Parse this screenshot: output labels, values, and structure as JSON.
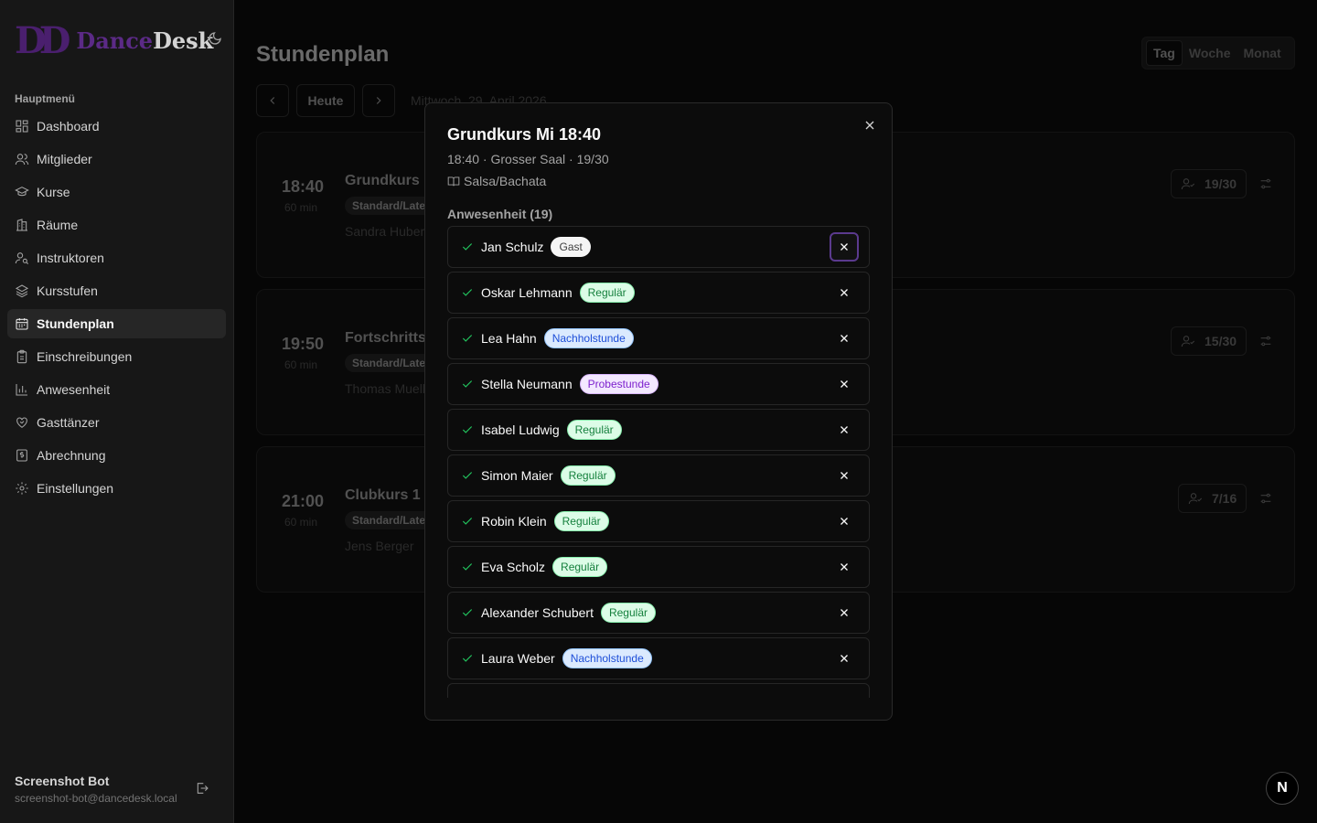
{
  "app": {
    "logo_mark": "DD",
    "logo_part1": "Dance",
    "logo_part2": "Desk",
    "nav_title": "Hauptmenü",
    "nav": [
      {
        "label": "Dashboard",
        "icon": "dashboard-icon"
      },
      {
        "label": "Mitglieder",
        "icon": "users-icon"
      },
      {
        "label": "Kurse",
        "icon": "graduation-cap-icon"
      },
      {
        "label": "Räume",
        "icon": "building-icon"
      },
      {
        "label": "Instruktoren",
        "icon": "user-key-icon"
      },
      {
        "label": "Kursstufen",
        "icon": "layers-icon"
      },
      {
        "label": "Stundenplan",
        "icon": "calendar-icon",
        "active": true
      },
      {
        "label": "Einschreibungen",
        "icon": "clipboard-icon"
      },
      {
        "label": "Anwesenheit",
        "icon": "bar-chart-icon"
      },
      {
        "label": "Gasttänzer",
        "icon": "heart-handshake-icon"
      },
      {
        "label": "Abrechnung",
        "icon": "receipt-icon"
      },
      {
        "label": "Einstellungen",
        "icon": "gear-icon"
      }
    ],
    "user_name": "Screenshot Bot",
    "user_email": "screenshot-bot@dancedesk.local"
  },
  "header": {
    "title": "Stundenplan",
    "views": [
      "Tag",
      "Woche",
      "Monat"
    ],
    "active_view": "Tag",
    "today_label": "Heute",
    "date": "Mittwoch, 29. April 2026"
  },
  "sessions": [
    {
      "time": "18:40",
      "duration": "60 min",
      "name": "Grundkurs M",
      "tag": "Standard/Latei",
      "instructor": "Sandra Huber",
      "capacity": "19/30"
    },
    {
      "time": "19:50",
      "duration": "60 min",
      "name": "Fortschrittsk",
      "tag": "Standard/Latei",
      "instructor": "Thomas Muell",
      "capacity": "15/30"
    },
    {
      "time": "21:00",
      "duration": "60 min",
      "name": "Clubkurs 1 M",
      "tag": "Standard/Latei",
      "instructor": "Jens Berger",
      "capacity": "7/16"
    }
  ],
  "modal": {
    "title": "Grundkurs Mi 18:40",
    "subtitle": "18:40 · Grosser Saal · 19/30",
    "style": "Salsa/Bachata",
    "section_title": "Anwesenheit (19)",
    "attendees": [
      {
        "name": "Jan Schulz",
        "type": "Gast"
      },
      {
        "name": "Oskar Lehmann",
        "type": "Regulär"
      },
      {
        "name": "Lea Hahn",
        "type": "Nachholstunde"
      },
      {
        "name": "Stella Neumann",
        "type": "Probestunde"
      },
      {
        "name": "Isabel Ludwig",
        "type": "Regulär"
      },
      {
        "name": "Simon Maier",
        "type": "Regulär"
      },
      {
        "name": "Robin Klein",
        "type": "Regulär"
      },
      {
        "name": "Eva Scholz",
        "type": "Regulär"
      },
      {
        "name": "Alexander Schubert",
        "type": "Regulär"
      },
      {
        "name": "Laura Weber",
        "type": "Nachholstunde"
      }
    ]
  },
  "dev_badge": "N",
  "colors": {
    "accent": "#5b2a86",
    "success": "#22c55e"
  }
}
